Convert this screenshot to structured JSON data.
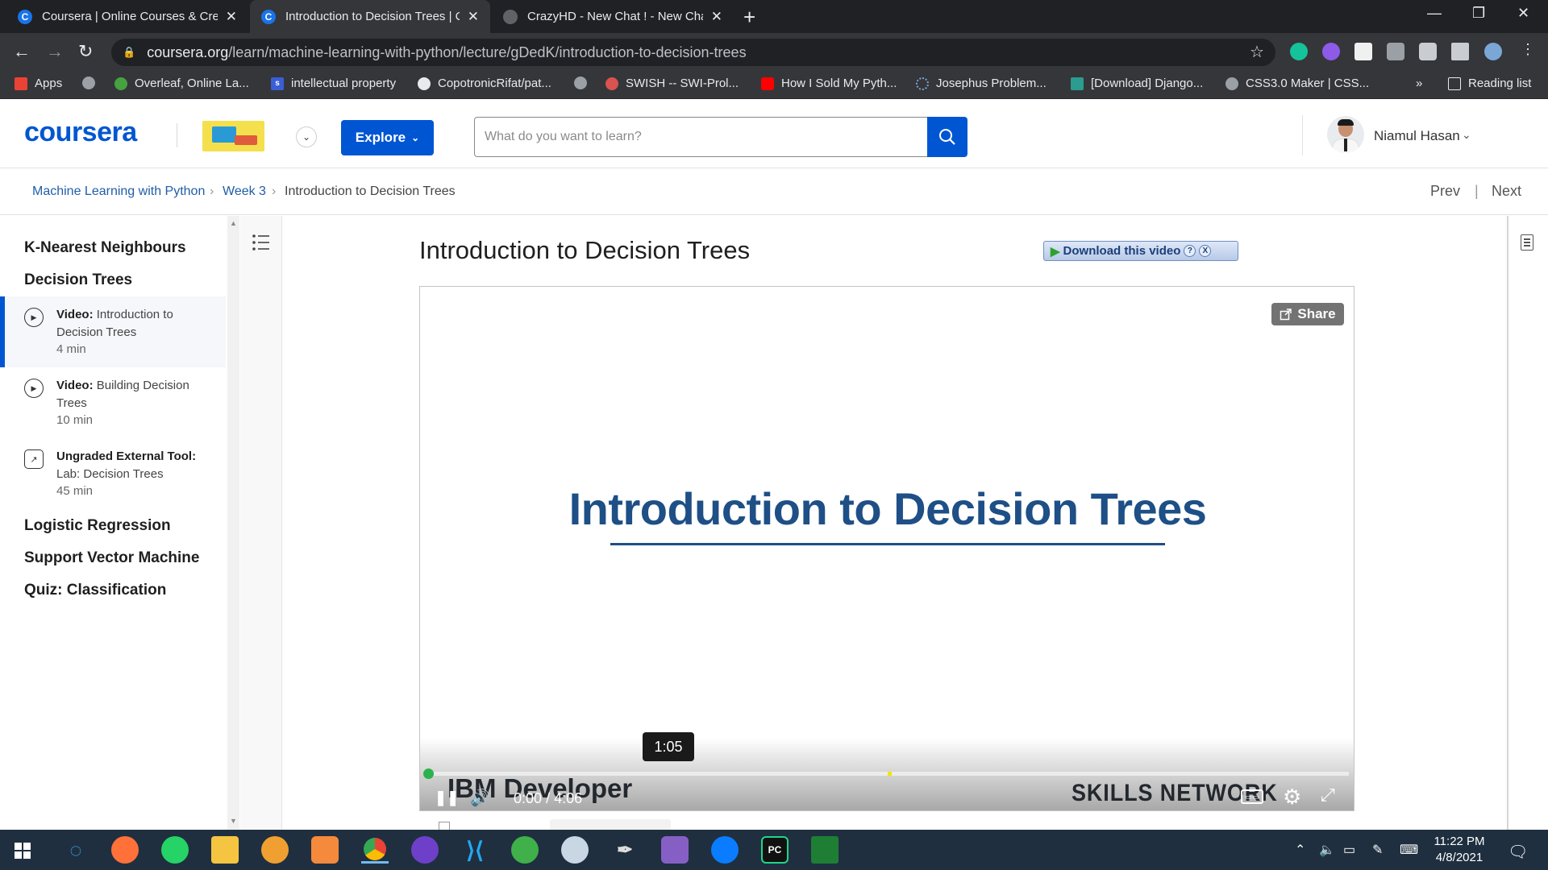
{
  "browser": {
    "tabs": [
      {
        "title": "Coursera | Online Courses & Cre",
        "favicon": "C"
      },
      {
        "title": "Introduction to Decision Trees | C",
        "favicon": "C"
      },
      {
        "title": "CrazyHD - New Chat ! - New Cha",
        "favicon": ""
      }
    ],
    "url_host": "coursera.org",
    "url_path": "/learn/machine-learning-with-python/lecture/gDedK/introduction-to-decision-trees",
    "bookmarks": [
      "Apps",
      "Overleaf, Online La...",
      "intellectual property",
      "CopotronicRifat/pat...",
      "SWISH -- SWI-Prol...",
      "How I Sold My Pyth...",
      "Josephus Problem...",
      "[Download] Django...",
      "CSS3.0 Maker | CSS..."
    ],
    "bookmarks_more": "»",
    "reading_list": "Reading list"
  },
  "header": {
    "logo": "coursera",
    "explore": "Explore",
    "search_placeholder": "What do you want to learn?",
    "user_name": "Niamul Hasan"
  },
  "breadcrumb": {
    "course": "Machine Learning with Python",
    "week": "Week 3",
    "current": "Introduction to Decision Trees",
    "prev": "Prev",
    "next": "Next"
  },
  "sidebar": {
    "sections": [
      "K-Nearest Neighbours",
      "Decision Trees",
      "Logistic Regression",
      "Support Vector Machine",
      "Quiz: Classification"
    ],
    "items": [
      {
        "kind": "Video:",
        "title": "Introduction to Decision Trees",
        "duration": "4 min",
        "icon": "play-icon"
      },
      {
        "kind": "Video:",
        "title": "Building Decision Trees",
        "duration": "10 min",
        "icon": "play-icon"
      },
      {
        "kind": "Ungraded External Tool:",
        "title": "Lab: Decision Trees",
        "duration": "45 min",
        "icon": "external-link-icon"
      }
    ]
  },
  "lecture": {
    "title": "Introduction to Decision Trees",
    "download_label": "Download this video",
    "help": "?",
    "close": "X"
  },
  "player": {
    "share": "Share",
    "slide_title": "Introduction to Decision Trees",
    "brand_left": "IBM Developer",
    "brand_right": "SKILLS NETWORK",
    "hover_time": "1:05",
    "current_time": "0:00",
    "time_sep": "/",
    "duration": "4:06",
    "progress_fraction": 0.0,
    "marker_fraction": 0.5
  },
  "taskbar": {
    "time": "11:22 PM",
    "date": "4/8/2021"
  },
  "colors": {
    "accent": "#0056d2",
    "slide_blue": "#1e4f86",
    "progress_green": "#2bb24c"
  }
}
